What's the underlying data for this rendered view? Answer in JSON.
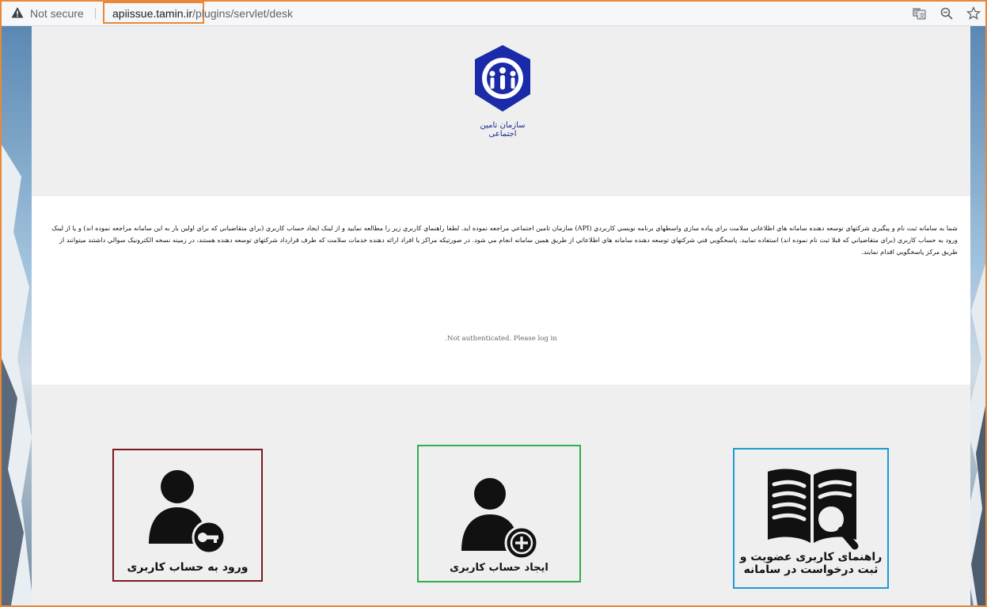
{
  "browser": {
    "security_label": "Not secure",
    "url_host": "apiissue.tamin.ir",
    "url_path": "/plugins/servlet/desk",
    "icons": [
      "warning-icon",
      "translate-icon",
      "zoom-icon",
      "star-icon"
    ]
  },
  "header": {
    "logo_caption": "سازمان تامین اجتماعی"
  },
  "intro": {
    "text": "شما به سامانه ثبت نام و پیگیري شرکتهاي توسعه دهنده سامانه هاي اطلاعاتي سلامت براي پياده سازي واسطهاي برنامه نويسي كاربردي (API) سازمان تامين اجتماعي مراجعه نموده ايد. لطفا راهنماي كاربري زير را مطالعه نماييد و از لینک ايجاد حساب كاربري (براي متقاضياني كه براي اولين بار به اين سامانه مراجعه نموده اند) و يا از لينک ورود به حساب كاربري (براي متقاضياني كه قبلا ثبت نام نموده اند) استفاده نماييد. پاسخگويي فني شركتهاي توسعه دهنده سامانه هاي اطلاعاتي از طريق همين سامانه انجام مي شود. در صورتيكه مراكز يا افراد ارائه دهنده خدمات سلامت كه طرف قرارداد شركتهاي توسعه دهنده هستند، در زمينه نسخه الكترونيک سوالي داشتند ميتوانند از طريق مركز پاسخگويي اقدام نمايند.",
    "status": ".Not authenticated. Please log in"
  },
  "cards": {
    "login": {
      "label": "ورود به حساب کاربری",
      "border_color": "#7b1a22"
    },
    "register": {
      "label": "ایجاد حساب کاربری",
      "border_color": "#2fae4e"
    },
    "guide": {
      "line1": "راهنمای کاربری عضویت و",
      "line2": "ثبت درخواست در سامانه",
      "border_color": "#1b9bd6"
    }
  },
  "colors": {
    "highlight": "#e8883a",
    "logo_blue": "#1a2aa8"
  }
}
